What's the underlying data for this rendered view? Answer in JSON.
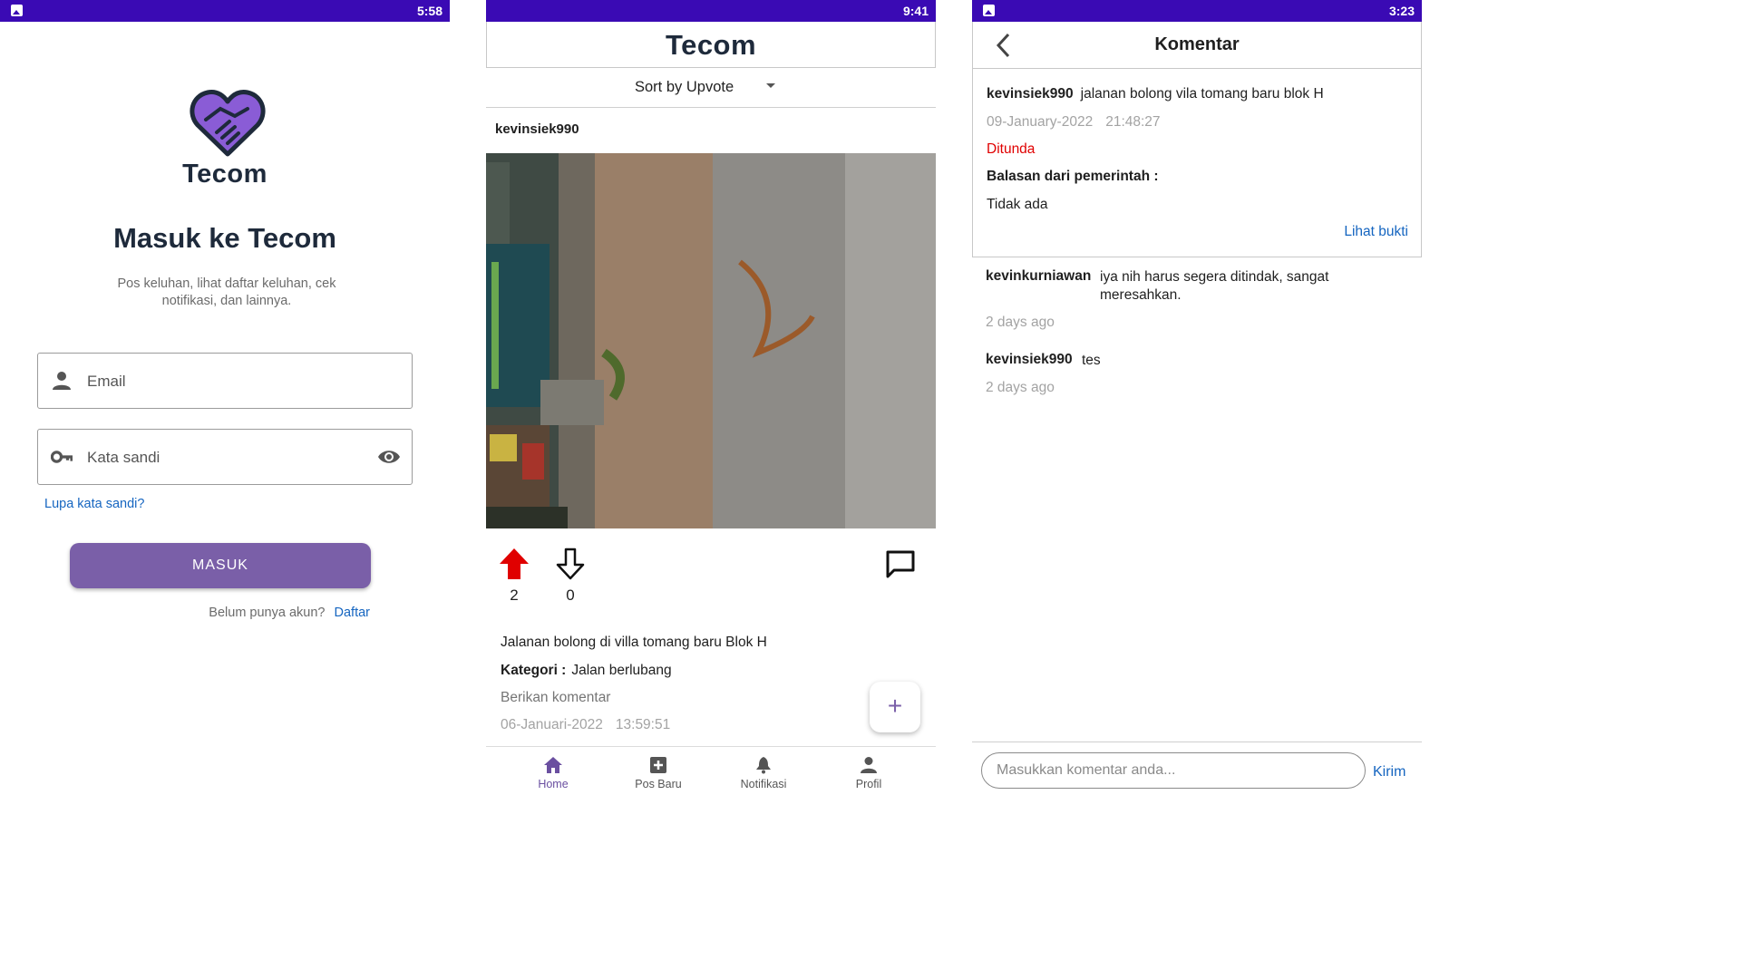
{
  "screen_login": {
    "status_time": "5:58",
    "brand": "Tecom",
    "title": "Masuk ke Tecom",
    "subtitle": "Pos keluhan, lihat daftar keluhan, cek notifikasi, dan lainnya.",
    "email_placeholder": "Email",
    "password_placeholder": "Kata sandi",
    "forgot_password": "Lupa kata sandi?",
    "login_button": "MASUK",
    "no_account": "Belum punya akun?",
    "register_link": "Daftar",
    "colors": {
      "status_bar": "#3a0ab4",
      "button": "#7a5fa8",
      "heart": "#8a5cd6",
      "link": "#1565c0"
    },
    "icons": [
      "logo-heart-icon",
      "person-icon",
      "key-icon",
      "eye-icon"
    ]
  },
  "screen_home": {
    "status_time": "9:41",
    "brand": "Tecom",
    "sort_label": "Sort by Upvote",
    "post": {
      "username": "kevinsiek990",
      "upvotes": "2",
      "downvotes": "0",
      "description": "Jalanan bolong di villa tomang baru Blok H",
      "category_label": "Kategori :",
      "category_value": "Jalan berlubang",
      "give_comment": "Berikan komentar",
      "date": "06-Januari-2022",
      "time": "13:59:51"
    },
    "fab_label": "+",
    "nav": [
      {
        "label": "Home",
        "icon": "home-icon",
        "active": true
      },
      {
        "label": "Pos Baru",
        "icon": "add-box-icon",
        "active": false
      },
      {
        "label": "Notifikasi",
        "icon": "bell-icon",
        "active": false
      },
      {
        "label": "Profil",
        "icon": "person-icon",
        "active": false
      }
    ],
    "colors": {
      "upvote": "#e00000",
      "active_nav": "#6a4fa0"
    }
  },
  "screen_comments": {
    "status_time": "3:23",
    "title": "Komentar",
    "report": {
      "username": "kevinsiek990",
      "text": "jalanan bolong vila tomang baru blok H",
      "date": "09-January-2022",
      "time": "21:48:27",
      "status": "Ditunda",
      "reply_label": "Balasan dari pemerintah :",
      "reply": "Tidak ada",
      "proof_link": "Lihat bukti"
    },
    "comments": [
      {
        "username": "kevinkurniawan",
        "text": "iya nih harus segera ditindak, sangat meresahkan.",
        "time": "2 days ago"
      },
      {
        "username": "kevinsiek990",
        "text": "tes",
        "time": "2 days ago"
      }
    ],
    "input_placeholder": "Masukkan komentar anda...",
    "send_label": "Kirim",
    "colors": {
      "status_pending": "#e00000"
    }
  }
}
